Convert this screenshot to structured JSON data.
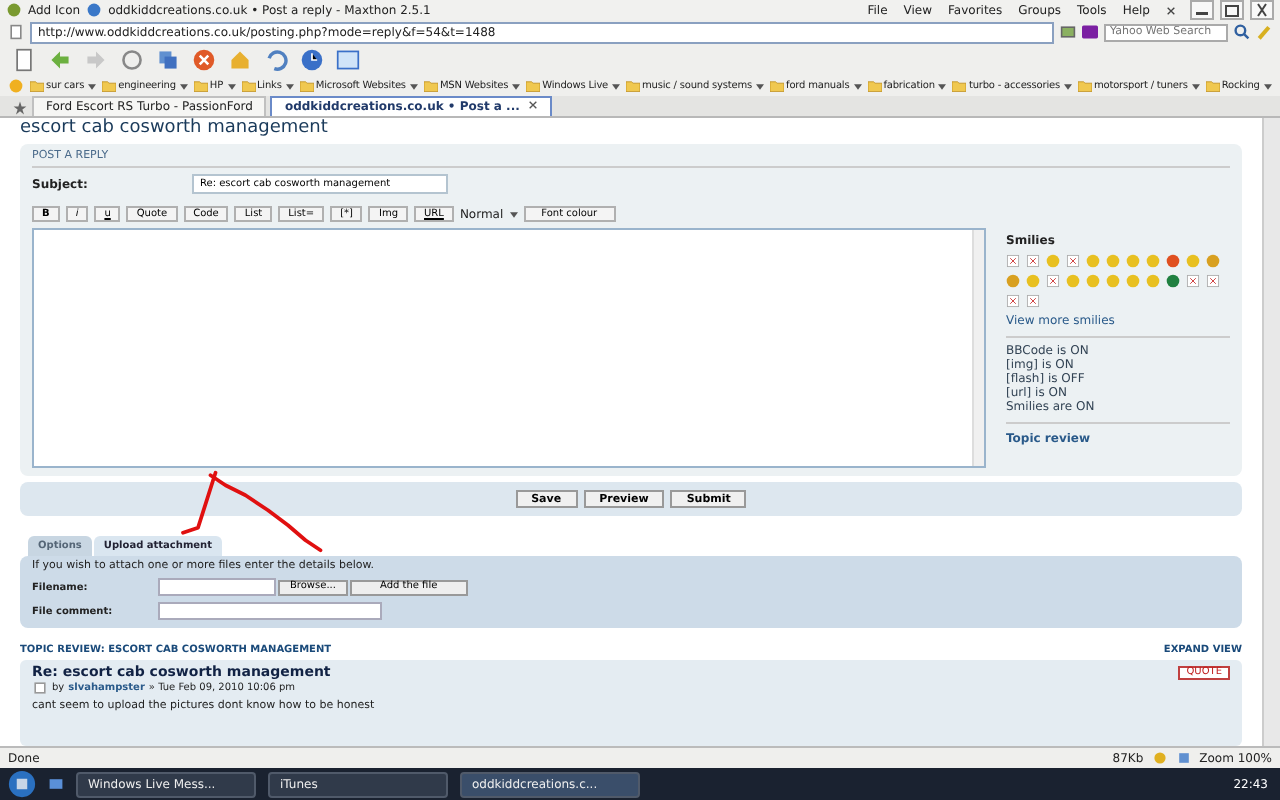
{
  "browser": {
    "add_icon": "Add Icon",
    "title": "oddkiddcreations.co.uk • Post a reply - Maxthon 2.5.1",
    "menu": [
      "File",
      "View",
      "Favorites",
      "Groups",
      "Tools",
      "Help"
    ],
    "address": "http://www.oddkiddcreations.co.uk/posting.php?mode=reply&f=54&t=1488",
    "search_placeholder": "Yahoo Web Search",
    "favorites": [
      "sur cars",
      "engineering",
      "HP",
      "Links",
      "Microsoft Websites",
      "MSN Websites",
      "Windows Live",
      "music / sound systems",
      "ford manuals",
      "fabrication",
      "turbo - accessories",
      "motorsport / tuners",
      "Rocking"
    ],
    "tabs": [
      {
        "label": "Ford Escort RS Turbo - PassionFord",
        "selected": false
      },
      {
        "label": "oddkiddcreations.co.uk • Post a ...",
        "selected": true
      }
    ]
  },
  "page": {
    "topic_title": "escort cab cosworth management",
    "section_label": "POST A REPLY",
    "subject_label": "Subject:",
    "subject_value": "Re: escort cab cosworth management",
    "editor_buttons": [
      {
        "label": "B",
        "kind": "bold"
      },
      {
        "label": "i",
        "kind": "italic"
      },
      {
        "label": "u",
        "kind": "underline"
      },
      {
        "label": "Quote",
        "kind": "plain"
      },
      {
        "label": "Code",
        "kind": "plain"
      },
      {
        "label": "List",
        "kind": "plain"
      },
      {
        "label": "List=",
        "kind": "plain"
      },
      {
        "label": "[*]",
        "kind": "plain"
      },
      {
        "label": "Img",
        "kind": "plain"
      },
      {
        "label": "URL",
        "kind": "underline"
      }
    ],
    "font_size": "Normal",
    "font_colour": "Font colour",
    "smilies_title": "Smilies",
    "smilies": [
      {
        "kind": "broken"
      },
      {
        "kind": "broken"
      },
      {
        "kind": "face",
        "color": "#e8c020"
      },
      {
        "kind": "broken"
      },
      {
        "kind": "face",
        "color": "#e8c020"
      },
      {
        "kind": "face",
        "color": "#e8c020"
      },
      {
        "kind": "face",
        "color": "#e8c020"
      },
      {
        "kind": "face",
        "color": "#e8c020"
      },
      {
        "kind": "face",
        "color": "#e05020"
      },
      {
        "kind": "face",
        "color": "#e8c020"
      },
      {
        "kind": "face",
        "color": "#d8a020"
      },
      {
        "kind": "face",
        "color": "#d8a020"
      },
      {
        "kind": "face",
        "color": "#e8c020"
      },
      {
        "kind": "broken"
      },
      {
        "kind": "face",
        "color": "#e8c020"
      },
      {
        "kind": "face",
        "color": "#e8c020"
      },
      {
        "kind": "face",
        "color": "#e8c020"
      },
      {
        "kind": "face",
        "color": "#e8c020"
      },
      {
        "kind": "face",
        "color": "#e8c020"
      },
      {
        "kind": "face",
        "color": "#208040"
      },
      {
        "kind": "broken"
      },
      {
        "kind": "broken"
      },
      {
        "kind": "broken"
      },
      {
        "kind": "broken"
      }
    ],
    "view_more": "View more smilies",
    "bbcode_status": [
      "BBCode is ON",
      "[img] is ON",
      "[flash] is OFF",
      "[url] is ON",
      "Smilies are ON"
    ],
    "topic_review_link": "Topic review",
    "actions": [
      "Save",
      "Preview",
      "Submit"
    ],
    "option_tabs": [
      {
        "label": "Options",
        "selected": false
      },
      {
        "label": "Upload attachment",
        "selected": true
      }
    ],
    "attach_hint": "If you wish to attach one or more files enter the details below.",
    "filename_label": "Filename:",
    "browse": "Browse...",
    "add_file": "Add the file",
    "comment_label": "File comment:",
    "review_heading": "TOPIC REVIEW: ESCORT CAB COSWORTH MANAGEMENT",
    "expand": "EXPAND VIEW",
    "post": {
      "title": "Re: escort cab cosworth management",
      "by": "by",
      "author": "slvahampster",
      "date": "» Tue Feb 09, 2010 10:06 pm",
      "quote": "QUOTE",
      "body": "cant seem to upload the pictures dont know how to be honest"
    }
  },
  "status_bar": {
    "text": "Done",
    "size": "87Kb",
    "zoom": "Zoom 100%"
  },
  "taskbar": {
    "items": [
      {
        "label": "Windows Live Mess...",
        "selected": false
      },
      {
        "label": "iTunes",
        "selected": false
      },
      {
        "label": "oddkiddcreations.c...",
        "selected": true
      }
    ],
    "time": "22:43"
  }
}
